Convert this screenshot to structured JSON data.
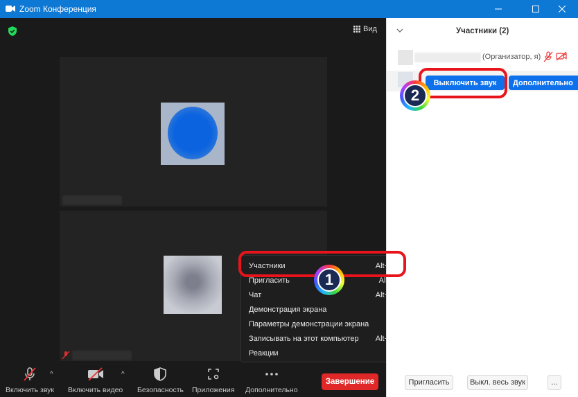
{
  "window": {
    "title": "Zoom Конференция"
  },
  "video": {
    "view_label": "Вид"
  },
  "toolbar": {
    "mute_label": "Включить звук",
    "video_label": "Включить видео",
    "security_label": "Безопасность",
    "apps_label": "Приложения",
    "more_label": "Дополнительно",
    "end_label": "Завершение"
  },
  "menu": {
    "items": [
      {
        "label": "Участники",
        "shortcut": "Alt+U"
      },
      {
        "label": "Пригласить",
        "shortcut": "Alt+I"
      },
      {
        "label": "Чат",
        "shortcut": "Alt+H"
      },
      {
        "label": "Демонстрация экрана",
        "shortcut": ""
      },
      {
        "label": "Параметры демонстрации экрана",
        "shortcut": ""
      },
      {
        "label": "Записывать на этот компьютер",
        "shortcut": "Alt+R"
      },
      {
        "label": "Реакции",
        "shortcut": ""
      }
    ]
  },
  "panel": {
    "title": "Участники (2)",
    "host_role": "(Организатор, я)",
    "mute_button": "Выключить звук",
    "more_button": "Дополнительно",
    "invite_button": "Пригласить",
    "mute_all_button": "Выкл. весь звук",
    "ellipsis_button": "..."
  },
  "annotations": {
    "step1": "1",
    "step2": "2"
  },
  "colors": {
    "titlebar": "#0e78d5",
    "highlight": "#e8141c",
    "end_button": "#e02828",
    "primary_button": "#0e71eb"
  },
  "icons": [
    "zoom-icon",
    "shield-icon",
    "grid-icon",
    "mic-muted-icon",
    "video-off-icon",
    "security-shield-icon",
    "apps-icon",
    "more-dots-icon",
    "chevron-down-icon"
  ]
}
